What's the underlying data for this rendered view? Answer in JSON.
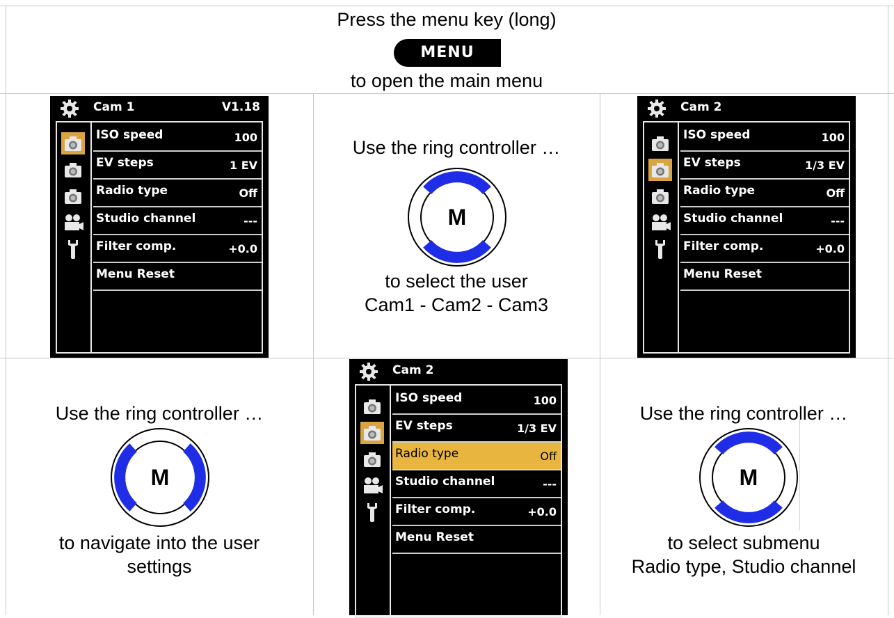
{
  "top": {
    "line1": "Press the menu key (long)",
    "menu_key": "MENU",
    "line3": "to open the main menu"
  },
  "screen1": {
    "title": "Cam 1",
    "version": "V1.18",
    "selected_icon": 0,
    "rows": [
      {
        "label": "ISO speed",
        "value": "100"
      },
      {
        "label": "EV steps",
        "value": "1 EV"
      },
      {
        "label": "Radio type",
        "value": "Off"
      },
      {
        "label": "Studio channel",
        "value": "---"
      },
      {
        "label": "Filter comp.",
        "value": "+0.0"
      },
      {
        "label": "Menu Reset",
        "value": ""
      }
    ]
  },
  "ring1": {
    "line1": "Use the ring controller …",
    "key": "M",
    "line2": "to select the user",
    "line3": "Cam1 - Cam2 - Cam3"
  },
  "screen2": {
    "title": "Cam 2",
    "selected_icon": 1,
    "rows": [
      {
        "label": "ISO speed",
        "value": "100"
      },
      {
        "label": "EV steps",
        "value": "1/3 EV"
      },
      {
        "label": "Radio type",
        "value": "Off"
      },
      {
        "label": "Studio channel",
        "value": "---"
      },
      {
        "label": "Filter comp.",
        "value": "+0.0"
      },
      {
        "label": "Menu Reset",
        "value": ""
      }
    ]
  },
  "ring2": {
    "line1": "Use the ring controller …",
    "key": "M",
    "line2": "to navigate into the user",
    "line3": "settings"
  },
  "screen3": {
    "title": "Cam 2",
    "selected_icon": 1,
    "highlighted_row": 2,
    "rows": [
      {
        "label": "ISO speed",
        "value": "100"
      },
      {
        "label": "EV steps",
        "value": "1/3 EV"
      },
      {
        "label": "Radio type",
        "value": "Off"
      },
      {
        "label": "Studio channel",
        "value": "---"
      },
      {
        "label": "Filter comp.",
        "value": "+0.0"
      },
      {
        "label": "Menu Reset",
        "value": ""
      }
    ]
  },
  "ring3": {
    "line1": "Use the ring controller …",
    "key": "M",
    "line2": "to select submenu",
    "line3": "Radio type, Studio channel"
  },
  "icons": [
    "camera-icon",
    "camera-icon",
    "camera-icon",
    "video-camera-icon",
    "wrench-icon"
  ],
  "colors": {
    "ring_blue": "#1f2ee6",
    "selected_icon": "#d9a441",
    "highlight_row": "#e8b53e"
  }
}
